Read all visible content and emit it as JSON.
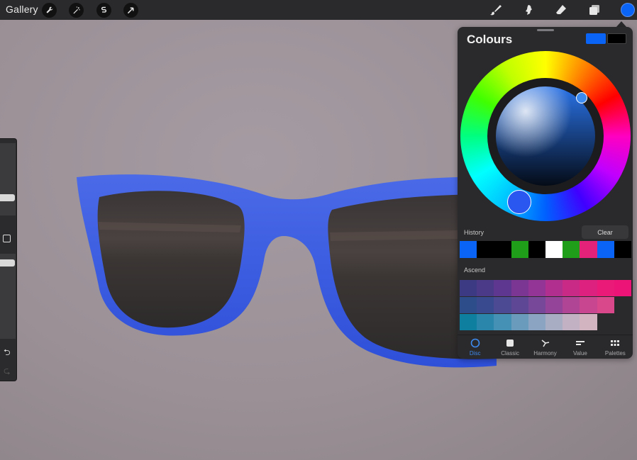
{
  "topbar": {
    "gallery_label": "Gallery",
    "left_tools": [
      "wrench-icon",
      "magic-wand-icon",
      "selection-icon",
      "transform-icon"
    ],
    "right_tools": [
      "brush-icon",
      "smudge-icon",
      "eraser-icon",
      "layers-icon"
    ],
    "active_color": "#0a64f5"
  },
  "sidebar": {
    "size_slider_icon": "size-slider",
    "modify_icon": "square-icon",
    "opacity_slider_icon": "opacity-slider",
    "undo_glyph": "⮌",
    "redo_glyph": "⮎"
  },
  "colours_panel": {
    "title": "Colours",
    "primary_color": "#0a64f5",
    "secondary_color": "#000000",
    "history_label": "History",
    "clear_label": "Clear",
    "history_colors": [
      "#0a64f5",
      "#000000",
      "#000000",
      "#1f9e1a",
      "#000000",
      "#ffffff",
      "#1f9e1a",
      "#e5227a",
      "#0a64f5",
      "#000000"
    ],
    "palette_label": "Ascend",
    "palette_rows": [
      [
        "#3b3a82",
        "#4a3a88",
        "#5e3890",
        "#7a3692",
        "#923596",
        "#b02f8f",
        "#c82a86",
        "#dc217f",
        "#e91a78",
        "#ec1477"
      ],
      [
        "#2c4c8a",
        "#3a4a8e",
        "#4b4a93",
        "#5e4896",
        "#77479a",
        "#94459a",
        "#b04596",
        "#c84590",
        "#d9488b"
      ],
      [
        "#0f7fa0",
        "#2b86ab",
        "#4590b5",
        "#6a9bbd",
        "#8ba4c2",
        "#a8adc4",
        "#c2b1c2",
        "#d2b4c0"
      ]
    ],
    "tabs": [
      {
        "label": "Disc",
        "icon": "disc-icon",
        "active": true
      },
      {
        "label": "Classic",
        "icon": "classic-icon",
        "active": false
      },
      {
        "label": "Harmony",
        "icon": "harmony-icon",
        "active": false
      },
      {
        "label": "Value",
        "icon": "value-icon",
        "active": false
      },
      {
        "label": "Palettes",
        "icon": "palettes-icon",
        "active": false
      }
    ]
  }
}
